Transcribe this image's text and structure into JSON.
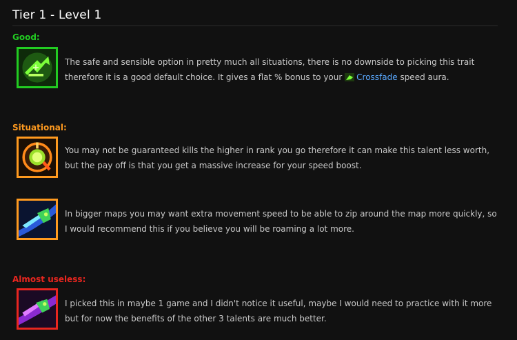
{
  "header": {
    "title": "Tier 1 - Level 1"
  },
  "sections": {
    "good": {
      "label": "Good:",
      "color": "#22cc22",
      "entries": [
        {
          "icon": "crossfade-trait-icon",
          "text_before": "The safe and sensible option in pretty much all situations, there is no downside to picking this trait therefore it is a good default choice. It gives a flat % bonus to your ",
          "link": "Crossfade",
          "link_icon": "crossfade-icon",
          "text_after": " speed aura."
        }
      ]
    },
    "situational": {
      "label": "Situational:",
      "color": "#ff9a1f",
      "entries": [
        {
          "icon": "speed-gauge-icon",
          "text": "You may not be guaranteed kills the higher in rank you go therefore it can make this talent less worth, but the pay off is that you get a massive increase for your speed boost."
        },
        {
          "icon": "dash-blade-icon",
          "text": "In bigger maps you may want extra movement speed to be able to zip around the map more quickly, so I would recommend this if you believe you will be roaming a lot more."
        }
      ]
    },
    "useless": {
      "label": "Almost useless:",
      "color": "#e8261f",
      "entries": [
        {
          "icon": "purple-dash-icon",
          "text": "I picked this in maybe 1 game and I didn't notice it useful, maybe I would need to practice with it more but for now the benefits of the other 3 talents are much better."
        }
      ]
    }
  }
}
